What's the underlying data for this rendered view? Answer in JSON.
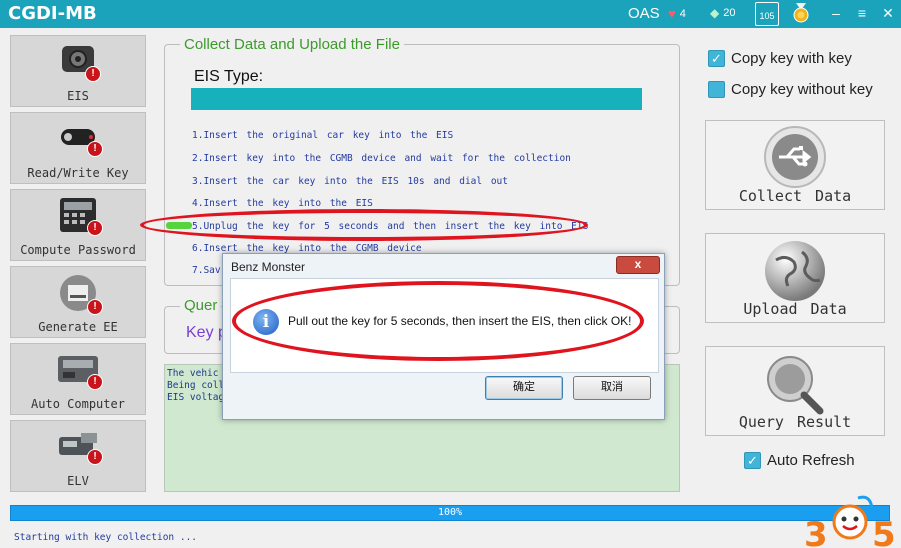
{
  "titlebar": {
    "app_title": "CGDI-MB",
    "oas": "OAS",
    "hearts": "4",
    "diamonds": "20",
    "calendar": "105",
    "minimize": "–",
    "menu": "≡",
    "close": "✕"
  },
  "sidebar": {
    "items": [
      {
        "label": "EIS",
        "icon": "eis-icon"
      },
      {
        "label": "Read/Write Key",
        "icon": "car-key-icon"
      },
      {
        "label": "Compute Password",
        "icon": "calculator-icon"
      },
      {
        "label": "Generate EE",
        "icon": "printer-icon"
      },
      {
        "label": "Auto Computer",
        "icon": "ecu-icon"
      },
      {
        "label": "ELV",
        "icon": "steering-lock-icon"
      }
    ]
  },
  "collect": {
    "title": "Collect Data and Upload the File",
    "eis_type_label": "EIS Type:",
    "steps": [
      "1.Insert the original car key into the EIS",
      "2.Insert key into the CGMB device and wait for the collection",
      "3.Insert the car key into the EIS 10s and dial out",
      "4.Insert the key into the EIS",
      "5.Unplug the key for 5 seconds and then insert the key into EIS",
      "6.Insert the key into the CGMB device",
      "7.Sav"
    ]
  },
  "query": {
    "title": "Quer",
    "key_label": "Key p"
  },
  "log": {
    "lines": [
      "The vehic",
      "Being coll",
      "EIS voltag"
    ]
  },
  "options": {
    "copy_with_key": "Copy key with key",
    "copy_without_key": "Copy key without key",
    "auto_refresh": "Auto Refresh"
  },
  "actions": {
    "collect": "Collect Data",
    "upload": "Upload  Data",
    "query": "Query Result"
  },
  "progress": {
    "value": 100,
    "text": "100%"
  },
  "status": "Starting with key collection ...",
  "dialog": {
    "title": "Benz Monster",
    "close": "x",
    "message": "Pull out the key for 5 seconds, then insert the EIS, then click OK!",
    "ok": "确定",
    "cancel": "取消"
  },
  "watermark": {
    "text": "305"
  },
  "colors": {
    "titlebar": "#1aa3bb",
    "accent": "#16b1bd",
    "group_title": "#3b9b2b",
    "highlight": "#e0141e",
    "progress": "#1a9ff0"
  }
}
